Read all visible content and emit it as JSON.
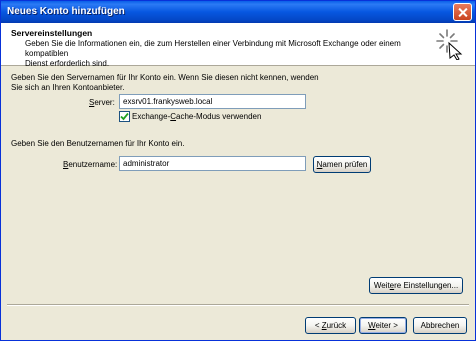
{
  "window": {
    "title": "Neues Konto hinzufügen"
  },
  "header": {
    "title": "Servereinstellungen",
    "description_line1": "Geben Sie die Informationen ein, die zum Herstellen einer Verbindung mit Microsoft Exchange oder einem kompatiblen",
    "description_line2": "Dienst erforderlich sind."
  },
  "server_section": {
    "intro_line1": "Geben Sie den Servernamen für Ihr Konto ein. Wenn Sie diesen nicht kennen, wenden",
    "intro_line2": "Sie sich an Ihren Kontoanbieter.",
    "server_label_accel": "S",
    "server_label_rest": "erver:",
    "server_value": "exsrv01.frankysweb.local",
    "cache_accel": "C",
    "cache_pre": "Exchange-",
    "cache_post": "ache-Modus verwenden",
    "cache_checked": true
  },
  "user_section": {
    "intro": "Geben Sie den Benutzernamen für Ihr Konto ein.",
    "username_label_accel": "B",
    "username_label_rest": "enutzername:",
    "username_value": "administrator",
    "check_names_accel": "N",
    "check_names_rest": "amen prüfen"
  },
  "buttons": {
    "more_settings_pre": "Weit",
    "more_settings_accel": "e",
    "more_settings_post": "re Einstellungen...",
    "back_pre": "< ",
    "back_accel": "Z",
    "back_post": "urück",
    "next_accel": "W",
    "next_post": "eiter >",
    "cancel": "Abbrechen"
  },
  "icons": {
    "close": "close-icon",
    "wizard": "wizard-sparkle-icon",
    "check": "checkmark-icon"
  }
}
